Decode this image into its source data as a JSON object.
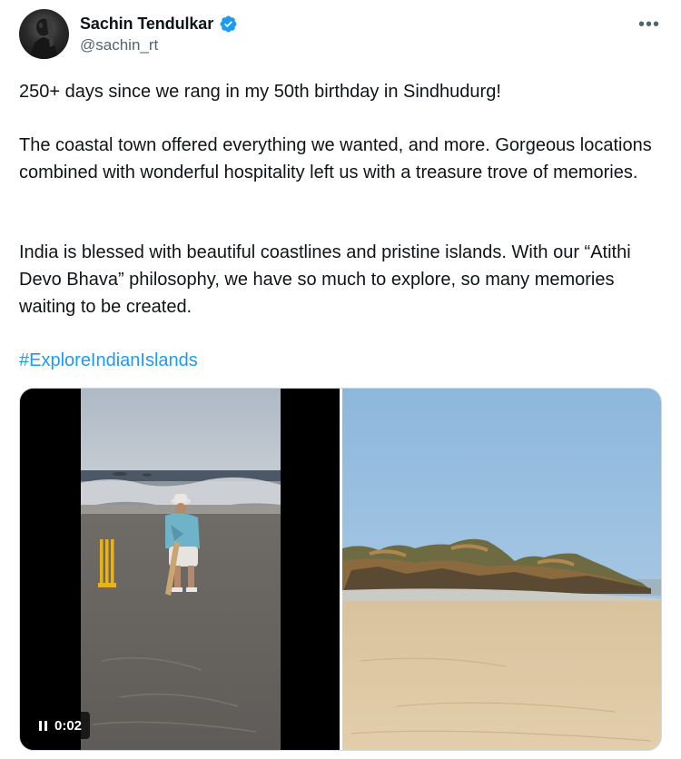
{
  "author": {
    "name": "Sachin Tendulkar",
    "handle": "@sachin_rt",
    "verified_icon": "verified-badge-icon",
    "verified_color": "#1d9bf0"
  },
  "menu": {
    "more_label": "•••"
  },
  "tweet": {
    "paragraphs": [
      "250+ days since we rang in my 50th birthday in Sindhudurg!",
      "The coastal town offered everything we wanted, and more. Gorgeous locations combined with wonderful hospitality left us with a treasure trove of memories.",
      "India is blessed with beautiful coastlines and pristine islands. With our “Atithi Devo Bhava” philosophy, we have so much to explore, so many memories waiting to be created."
    ],
    "hashtag": "#ExploreIndianIslands",
    "link_color": "#1d9bf0"
  },
  "media": {
    "video": {
      "timestamp": "0:02",
      "control_icon": "pause-icon"
    },
    "photo": {
      "icon": "beach-photo"
    }
  }
}
